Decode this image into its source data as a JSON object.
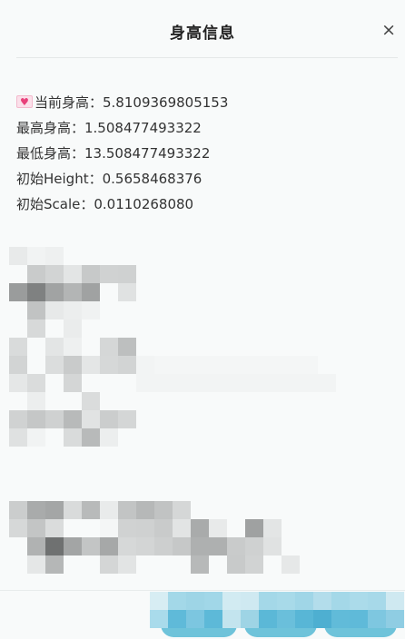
{
  "dialog": {
    "title": "身高信息",
    "close_glyph": "×"
  },
  "info": {
    "current_height": "当前身高：5.8109369805153",
    "max_height": "最高身高：1.508477493322",
    "min_height": "最低身高：13.508477493322",
    "initial_height": "初始Height：0.5658468376",
    "initial_scale": "初始Scale：0.0110268080"
  },
  "icons": {
    "current_height_icon": "love-letter-icon"
  },
  "colors": {
    "button_accent": "#6ec3da",
    "heart": "#e8407a"
  }
}
